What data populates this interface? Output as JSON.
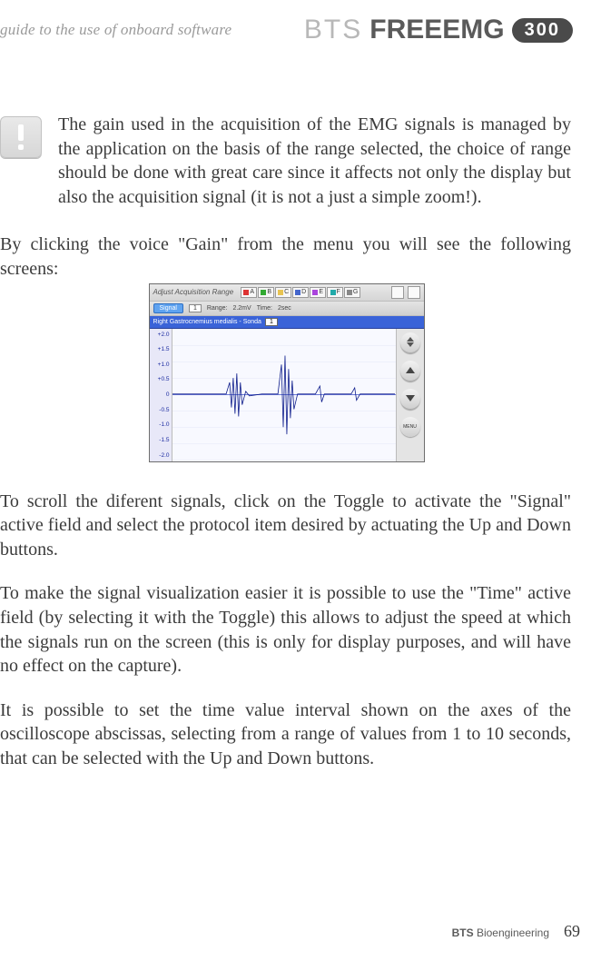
{
  "header": {
    "guide": "guide to the use of onboard software",
    "brand_bts": "BTS",
    "brand_freeemg": "FREEEMG",
    "brand_300": "300"
  },
  "note": "The gain used in the acquisition of the EMG signals is managed by the application on the basis of the range selected, the choice of range should be done with great care since it affects not only the display but also the acquisition signal (it is not a just a simple zoom!).",
  "para_click": "By clicking the voice \"Gain\" from the menu you will see the following screens:",
  "para_scroll": "To scroll the diferent signals, click on the Toggle to activate the \"Signal\" active field and select the protocol item desired by actuating the Up and Down buttons.",
  "para_time": "To make the signal visualization easier it is possible to use the \"Time\" active field (by selecting it with the Toggle) this allows to adjust the speed at which the signals run on the screen  (this is only for display purposes, and will have no effect on the capture).",
  "para_interval": "It is possible to set the time value interval shown on the axes of the oscilloscope abscissas, selecting from a range of values from 1 to 10 seconds,   that can be selected with the Up and Down buttons.",
  "screenshot": {
    "titlebar": "Adjust Acquisition Range",
    "channels": [
      "A",
      "B",
      "C",
      "D",
      "E",
      "F",
      "G"
    ],
    "infobar": {
      "signal_label": "Signal",
      "signal_num": "1",
      "range_label": "Range:",
      "range_value": "2.2mV",
      "time_label": "Time:",
      "time_value": "2sec"
    },
    "stripe": {
      "muscle": "Right Gastrocnemius medialis - Sonda",
      "sel": "1"
    },
    "yticks": [
      "+2.0",
      "+1.5",
      "+1.0",
      "+0.5",
      "0",
      "-0.5",
      "-1.0",
      "-1.5",
      "-2.0"
    ],
    "side": {
      "menu": "MENU"
    }
  },
  "footer": {
    "company_bold": "BTS",
    "company_rest": "Bioengineering",
    "page": "69"
  }
}
